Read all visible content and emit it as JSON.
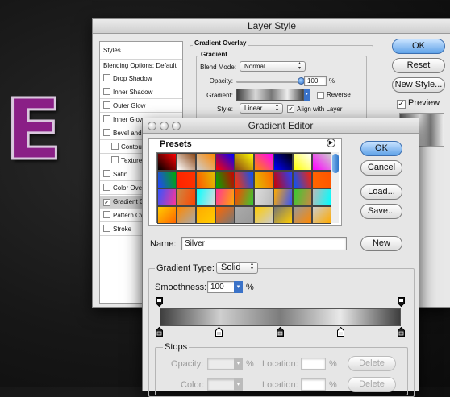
{
  "logo_letter": "E",
  "layer_style": {
    "title": "Layer Style",
    "styles_header": "Styles",
    "list": [
      {
        "label": "Blending Options: Default",
        "checkbox": false,
        "checked": false
      },
      {
        "label": "Drop Shadow",
        "checkbox": true,
        "checked": false
      },
      {
        "label": "Inner Shadow",
        "checkbox": true,
        "checked": false
      },
      {
        "label": "Outer Glow",
        "checkbox": true,
        "checked": false
      },
      {
        "label": "Inner Glow",
        "checkbox": true,
        "checked": false
      },
      {
        "label": "Bevel and Emboss",
        "checkbox": true,
        "checked": false
      },
      {
        "label": "Contour",
        "checkbox": true,
        "checked": false
      },
      {
        "label": "Texture",
        "checkbox": true,
        "checked": false
      },
      {
        "label": "Satin",
        "checkbox": true,
        "checked": false
      },
      {
        "label": "Color Overlay",
        "checkbox": true,
        "checked": false
      },
      {
        "label": "Gradient Overlay",
        "checkbox": true,
        "checked": true
      },
      {
        "label": "Pattern Overlay",
        "checkbox": true,
        "checked": false
      },
      {
        "label": "Stroke",
        "checkbox": true,
        "checked": false
      }
    ],
    "section_title": "Gradient Overlay",
    "subsection_title": "Gradient",
    "blend_mode_label": "Blend Mode:",
    "blend_mode_value": "Normal",
    "opacity_label": "Opacity:",
    "opacity_value": "100",
    "opacity_unit": "%",
    "opacity_level": 1.0,
    "gradient_label": "Gradient:",
    "reverse_label": "Reverse",
    "style_label": "Style:",
    "style_value": "Linear",
    "align_label": "Align with Layer",
    "buttons": {
      "ok": "OK",
      "reset": "Reset",
      "new_style": "New Style...",
      "preview": "Preview"
    }
  },
  "gradient_editor": {
    "title": "Gradient Editor",
    "presets_label": "Presets",
    "buttons": {
      "ok": "OK",
      "cancel": "Cancel",
      "load": "Load...",
      "save": "Save...",
      "new": "New"
    },
    "name_label": "Name:",
    "name_value": "Silver",
    "gradient_type_label": "Gradient Type:",
    "gradient_type_value": "Solid",
    "smoothness_label": "Smoothness:",
    "smoothness_value": "100",
    "smoothness_unit": "%",
    "stops_label": "Stops",
    "opacity_label": "Opacity:",
    "color_label": "Color:",
    "percent": "%",
    "location_label": "Location:",
    "delete_label": "Delete",
    "preset_colors": [
      [
        "#000000",
        "#ffffff",
        "#cccccc",
        "#ff0000",
        "#8b4513",
        "#ff8800",
        "#0000ff",
        "#ffff00",
        "#ff00ff"
      ],
      [
        "#2244ff",
        "#ff2200",
        "#ff5500",
        "#00aa00",
        "#ff3300",
        "#e0c000",
        "#cc0000",
        "#0055ff",
        "#ff6600"
      ],
      [
        "#3355ff",
        "#cc8844",
        "#00ffff",
        "#ff3399",
        "#ff4400",
        "#dddddd",
        "#ffaa00",
        "#33cc33",
        "#bbbbbb"
      ],
      [
        "#ffcc00",
        "#ff8800",
        "#ffaa00",
        "#ff6600",
        "#aaaaaa",
        "#ffcc00",
        "#777777",
        "#999999",
        "#cccccc"
      ]
    ]
  }
}
